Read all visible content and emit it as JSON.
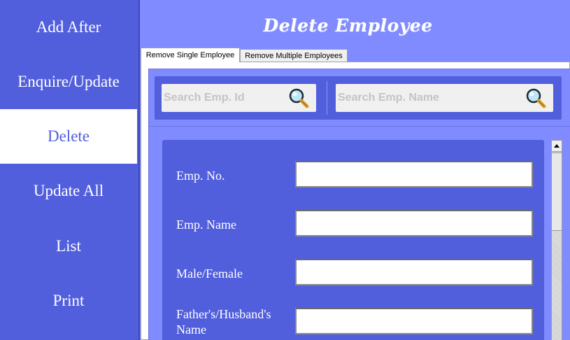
{
  "sidebar": {
    "items": [
      {
        "label": "Add After"
      },
      {
        "label": "Enquire/Update"
      },
      {
        "label": "Delete"
      },
      {
        "label": "Update All"
      },
      {
        "label": "List"
      },
      {
        "label": "Print"
      }
    ],
    "active_label": "Delete"
  },
  "header": {
    "title": "Delete Employee"
  },
  "tabs": [
    {
      "label": "Remove Single Employee",
      "selected": true
    },
    {
      "label": "Remove Multiple Employees",
      "selected": false
    }
  ],
  "search": {
    "emp_id_placeholder": "Search Emp. Id",
    "emp_name_placeholder": "Search Emp. Name",
    "icon": "magnifier-icon"
  },
  "form": {
    "fields": [
      {
        "label": "Emp. No.",
        "value": ""
      },
      {
        "label": "Emp. Name",
        "value": ""
      },
      {
        "label": "Male/Female",
        "value": ""
      },
      {
        "label": "Father's/Husband's Name",
        "value": ""
      }
    ]
  },
  "colors": {
    "sidebar_bg": "#525fdd",
    "content_bg": "#7f8bff",
    "card_bg": "#525fdd",
    "active_item_bg": "#ffffff",
    "text": "#ffffff"
  }
}
